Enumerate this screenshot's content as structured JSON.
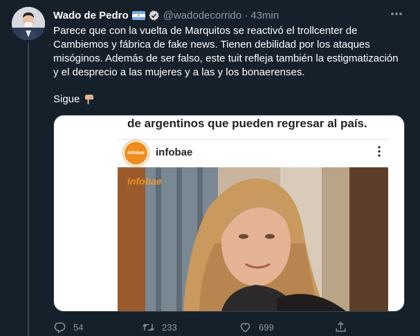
{
  "tweet": {
    "author_name": "Wado de Pedro",
    "handle": "@wadodecorrido",
    "separator": "·",
    "time": "43min",
    "text_lines": [
      "Parece que con la vuelta de Marquitos se reactivó el trollcenter de",
      "Cambiemos y fábrica de fake news. Tienen debilidad por los ataques",
      "misóginos. Además de ser falso, este tuit refleja también la estigmatización",
      "y el desprecio a las mujeres y a las y los bonaerenses."
    ],
    "sigue": "Sigue"
  },
  "media": {
    "headline": "de argentinos que pueden regresar al país.",
    "account_name": "infobae",
    "logo_text": "infobae",
    "watermark": "infobae"
  },
  "actions": {
    "reply_count": "54",
    "retweet_count": "233",
    "like_count": "699"
  },
  "colors": {
    "background": "#15202b",
    "secondary_text": "#8b98a5",
    "verified": "#d9d9d9",
    "infobae_orange": "#f08c1a"
  },
  "icons": [
    "avatar",
    "argentina-flag-icon",
    "verified-badge-icon",
    "more-options-icon",
    "pointing-down-hand-icon",
    "reply-icon",
    "retweet-icon",
    "like-icon",
    "share-icon",
    "instagram-more-icon"
  ]
}
